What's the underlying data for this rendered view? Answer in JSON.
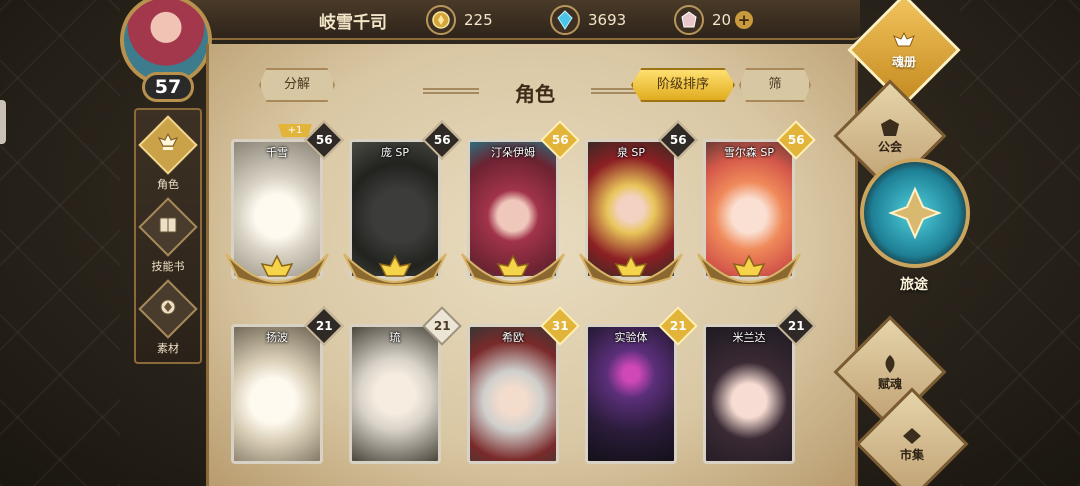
{
  "player": {
    "name": "岐雪千司",
    "level": "57"
  },
  "resources": [
    {
      "icon": "gold-coin-icon",
      "value": "225"
    },
    {
      "icon": "blue-crystal-icon",
      "value": "3693"
    },
    {
      "icon": "pink-gem-icon",
      "value": "20",
      "plus": "+"
    }
  ],
  "left_nav": [
    {
      "label": "角色",
      "icon": "character-crest-icon",
      "active": true
    },
    {
      "label": "技能书",
      "icon": "skill-book-icon",
      "active": false
    },
    {
      "label": "素材",
      "icon": "material-icon",
      "active": false
    }
  ],
  "panel": {
    "title": "角色",
    "decompose_label": "分解",
    "sort_label": "阶级排序",
    "filter_label": "筛选"
  },
  "characters": [
    {
      "name": "千雪",
      "level": "56",
      "tag": "dark",
      "plus": "+1"
    },
    {
      "name": "庞 SP",
      "level": "56",
      "tag": "dark"
    },
    {
      "name": "汀朵伊姆",
      "level": "56",
      "tag": "gold"
    },
    {
      "name": "泉 SP",
      "level": "56",
      "tag": "dark"
    },
    {
      "name": "雪尔森 SP",
      "level": "56",
      "tag": "gold"
    },
    {
      "name": "扬波",
      "level": "21",
      "tag": "dark"
    },
    {
      "name": "琉",
      "level": "21",
      "tag": "light"
    },
    {
      "name": "希欧",
      "level": "31",
      "tag": "gold"
    },
    {
      "name": "实验体",
      "level": "21",
      "tag": "gold"
    },
    {
      "name": "米兰达",
      "level": "21",
      "tag": "dark"
    }
  ],
  "right_menu": {
    "soul_book": "魂册",
    "guild": "公会",
    "journey": "旅途",
    "soul_gift": "赋魂",
    "market": "市集"
  },
  "colors": {
    "gold_accent": "#e2b43a",
    "parchment": "#e9dcc0",
    "frame": "#8c6a3a"
  }
}
